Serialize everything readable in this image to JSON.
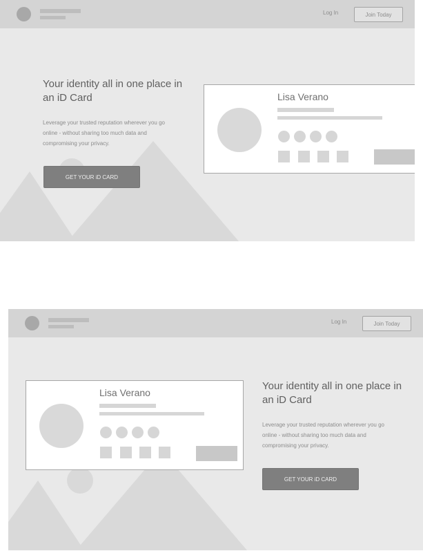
{
  "nav": {
    "login_label": "Log In",
    "join_label": "Join Today"
  },
  "hero": {
    "headline": "Your identity all in one place in an iD Card",
    "description": "Leverage your trusted reputation wherever you go online - without sharing too much data and compromising your privacy.",
    "cta_label": "GET YOUR iD CARD"
  },
  "card": {
    "name": "Lisa Verano"
  },
  "colors": {
    "background": "#e9e9e9",
    "nav": "#d4d4d4",
    "cta": "#7f7f7f",
    "mountain": "#d9d9d9"
  }
}
